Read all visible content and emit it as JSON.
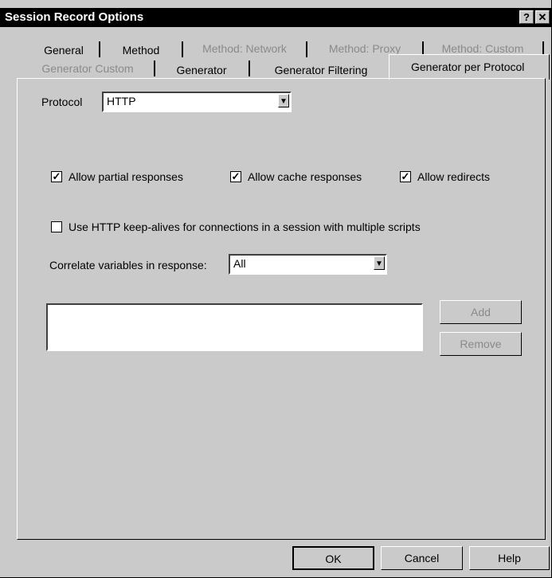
{
  "window": {
    "title": "Session Record Options",
    "help_btn": "?",
    "close_btn": "✕"
  },
  "tabs_row1": [
    {
      "label": "General",
      "enabled": true
    },
    {
      "label": "Method",
      "enabled": true
    },
    {
      "label": "Method: Network",
      "enabled": false
    },
    {
      "label": "Method: Proxy",
      "enabled": false
    },
    {
      "label": "Method: Custom",
      "enabled": false
    }
  ],
  "tabs_row2": [
    {
      "label": "Generator Custom",
      "enabled": false
    },
    {
      "label": "Generator",
      "enabled": true
    },
    {
      "label": "Generator Filtering",
      "enabled": true
    },
    {
      "label": "Generator per Protocol",
      "enabled": true,
      "selected": true
    }
  ],
  "protocol": {
    "label": "Protocol",
    "value": "HTTP"
  },
  "checkboxes": {
    "partial": {
      "label": "Allow partial responses",
      "checked": true
    },
    "cache": {
      "label": "Allow cache responses",
      "checked": true
    },
    "redirects": {
      "label": "Allow redirects",
      "checked": true
    },
    "keepalive": {
      "label": "Use HTTP keep-alives for connections in a session with multiple scripts",
      "checked": false
    }
  },
  "correlate": {
    "label": "Correlate variables in response:",
    "value": "All"
  },
  "list_buttons": {
    "add": "Add",
    "remove": "Remove"
  },
  "footer": {
    "ok": "OK",
    "cancel": "Cancel",
    "help": "Help"
  },
  "icons": {
    "dropdown": "▼",
    "check": "✓"
  }
}
